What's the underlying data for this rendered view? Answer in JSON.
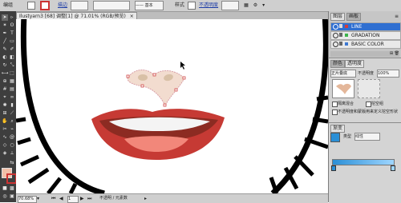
{
  "control_bar": {
    "selection_label": "编组",
    "stroke_label": "描边",
    "stroke_weight_label": "基本",
    "style_label": "样式",
    "opacity_label": "不透明度"
  },
  "document": {
    "tab_title": "Ilustyarn3 [68] 调整[1] @ 71.01% (RGB/预览)"
  },
  "status": {
    "zoom": "70.68%",
    "page": "1",
    "tool_label": "不透明 / 元素数"
  },
  "layers_panel": {
    "tabs": [
      "图层",
      "画板"
    ],
    "layers": [
      {
        "name": "LINE",
        "color": "#d23c3c",
        "selected": true
      },
      {
        "name": "GRADATION",
        "color": "#3cb44b",
        "selected": false
      },
      {
        "name": "BASIC COLOR",
        "color": "#3c78d2",
        "selected": false
      }
    ]
  },
  "transparency_panel": {
    "tabs": [
      "颜色",
      "透明度"
    ],
    "blend_mode": "正片叠底",
    "opacity_label": "不透明度",
    "opacity_value": "100%",
    "options": [
      "隔离混合",
      "挖空组",
      "不透明度和蒙版用来定义挖空形状"
    ]
  },
  "gradient_panel": {
    "tabs": [
      "渐变"
    ],
    "type_label": "类型",
    "type_value": "线性"
  },
  "colors": {
    "lip_outer": "#c63a34",
    "lip_dark": "#8c2b22",
    "tongue": "#f2877a",
    "teeth": "#f4f4f4",
    "nose": "#f2dccf",
    "nostril": "#d8c0a6",
    "gradient_start": "#2a8fd6",
    "gradient_end": "#9fd6ff"
  }
}
